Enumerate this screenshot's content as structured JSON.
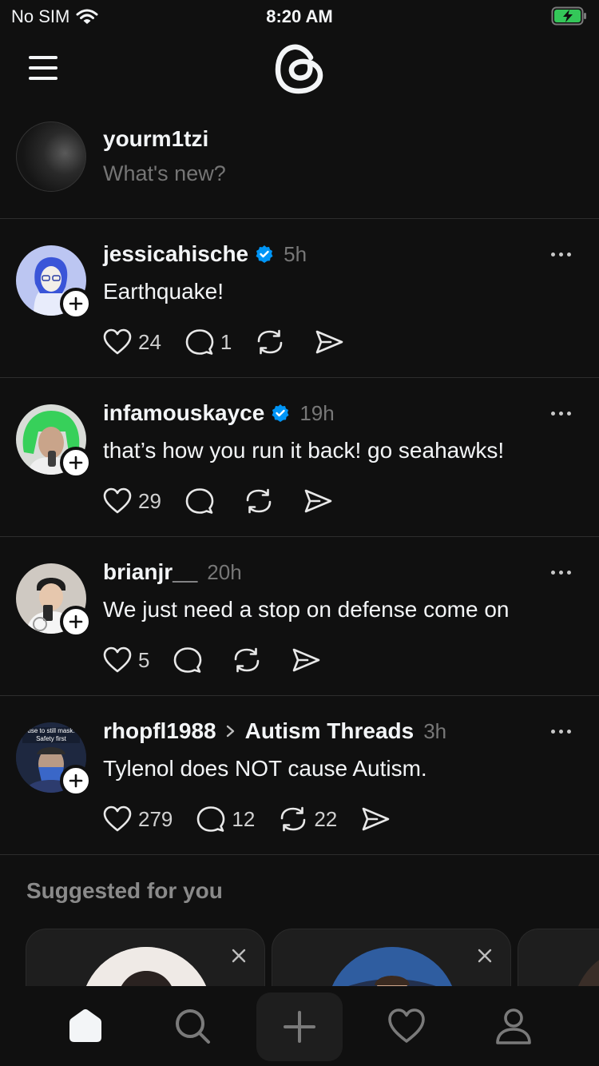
{
  "status": {
    "carrier": "No SIM",
    "time": "8:20 AM"
  },
  "header": {
    "logo_icon": "threads-logo-icon",
    "menu_icon": "menu-icon"
  },
  "composer": {
    "username": "yourm1tzi",
    "placeholder": "What's new?"
  },
  "posts": [
    {
      "username": "jessicahische",
      "verified": true,
      "time": "5h",
      "community": "",
      "text": "Earthquake!",
      "likes": "24",
      "replies": "1",
      "reposts": ""
    },
    {
      "username": "infamouskayce",
      "verified": true,
      "time": "19h",
      "community": "",
      "text": "that’s how you run it back! go seahawks!",
      "likes": "29",
      "replies": "",
      "reposts": ""
    },
    {
      "username": "brianjr__",
      "verified": false,
      "time": "20h",
      "community": "",
      "text": "We just need a stop on defense come on",
      "likes": "5",
      "replies": "",
      "reposts": ""
    },
    {
      "username": "rhopfl1988",
      "verified": false,
      "time": "3h",
      "community": "Autism Threads",
      "text": "Tylenol does NOT cause Autism.",
      "likes": "279",
      "replies": "12",
      "reposts": "22",
      "avatar_text": "use to still mask. Safety first"
    }
  ],
  "suggested": {
    "title": "Suggested for you"
  },
  "colors": {
    "background": "#101010",
    "verified": "#0095f6",
    "divider": "#2d2d2d"
  }
}
